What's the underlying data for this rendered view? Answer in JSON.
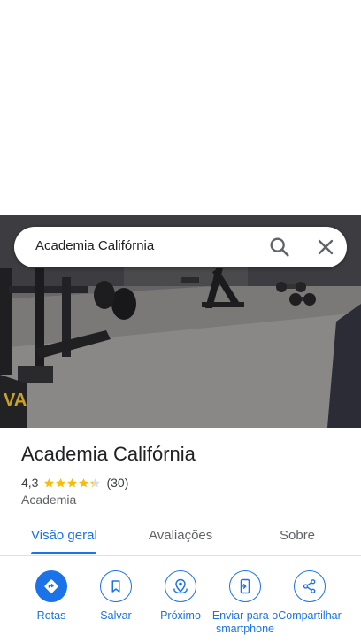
{
  "search": {
    "query": "Academia Califórnia"
  },
  "place": {
    "name": "Academia Califórnia",
    "rating": "4,3",
    "stars": 4.3,
    "reviews_count": "(30)",
    "category": "Academia"
  },
  "tabs": [
    {
      "label": "Visão geral",
      "active": true
    },
    {
      "label": "Avaliações",
      "active": false
    },
    {
      "label": "Sobre",
      "active": false
    }
  ],
  "actions": [
    {
      "label": "Rotas",
      "icon": "directions-icon"
    },
    {
      "label": "Salvar",
      "icon": "bookmark-icon"
    },
    {
      "label": "Próximo",
      "icon": "nearby-icon"
    },
    {
      "label": "Enviar para o smartphone",
      "icon": "send-to-phone-icon"
    },
    {
      "label": "Compartilhar",
      "icon": "share-icon"
    }
  ],
  "colors": {
    "accent": "#1a73e8",
    "star": "#fbbc04",
    "text": "#202124",
    "muted": "#5f6368"
  }
}
